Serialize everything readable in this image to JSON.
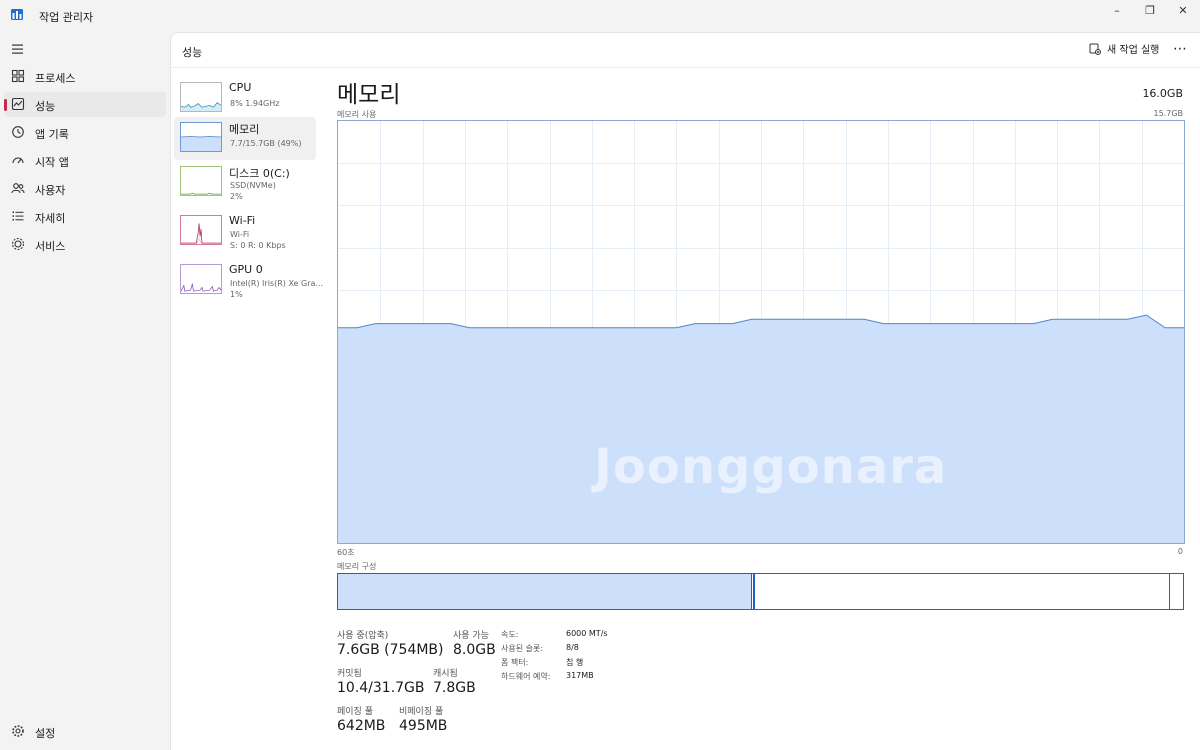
{
  "window": {
    "title": "작업 관리자",
    "minimize": "–",
    "restore": "❐",
    "close": "✕"
  },
  "nav": {
    "items": [
      {
        "label": "프로세스",
        "icon": "grid-icon"
      },
      {
        "label": "성능",
        "icon": "performance-icon"
      },
      {
        "label": "앱 기록",
        "icon": "history-icon"
      },
      {
        "label": "시작 앱",
        "icon": "startup-icon"
      },
      {
        "label": "사용자",
        "icon": "users-icon"
      },
      {
        "label": "자세히",
        "icon": "list-icon"
      },
      {
        "label": "서비스",
        "icon": "services-icon"
      }
    ],
    "settings_label": "설정"
  },
  "header": {
    "title": "성능",
    "run_task": "새 작업 실행",
    "more": "⋯"
  },
  "resources": [
    {
      "name": "CPU",
      "line1": "8% 1.94GHz",
      "line2": ""
    },
    {
      "name": "메모리",
      "line1": "7.7/15.7GB (49%)",
      "line2": ""
    },
    {
      "name": "디스크 0(C:)",
      "line1": "SSD(NVMe)",
      "line2": "2%"
    },
    {
      "name": "Wi-Fi",
      "line1": "Wi-Fi",
      "line2": "S: 0  R: 0 Kbps"
    },
    {
      "name": "GPU 0",
      "line1": "Intel(R) Iris(R) Xe Gra...",
      "line2": "1%"
    }
  ],
  "memory": {
    "title": "메모리",
    "total": "16.0GB",
    "usage_label": "메모리 사용",
    "usage_max": "15.7GB",
    "time_left": "60초",
    "time_right": "0",
    "composition_label": "메모리 구성",
    "composition_in_use_fraction": 0.49,
    "stats": {
      "in_use_label": "사용 중(압축)",
      "in_use_value": "7.6GB (754MB)",
      "available_label": "사용 가능",
      "available_value": "8.0GB",
      "committed_label": "커밋됨",
      "committed_value": "10.4/31.7GB",
      "cached_label": "캐시됨",
      "cached_value": "7.8GB",
      "paged_label": "페이징 풀",
      "paged_value": "642MB",
      "nonpaged_label": "비페이징 풀",
      "nonpaged_value": "495MB"
    },
    "specs": [
      {
        "label": "속도:",
        "value": "6000 MT/s"
      },
      {
        "label": "사용된 슬롯:",
        "value": "8/8"
      },
      {
        "label": "폼 팩터:",
        "value": "칩 행"
      },
      {
        "label": "하드웨어 예약:",
        "value": "317MB"
      }
    ],
    "usage_history_percent": [
      51,
      51,
      52,
      52,
      52,
      52,
      52,
      51,
      51,
      51,
      51,
      51,
      51,
      51,
      51,
      51,
      51,
      51,
      51,
      52,
      52,
      52,
      53,
      53,
      53,
      53,
      53,
      53,
      53,
      52,
      52,
      52,
      52,
      52,
      52,
      52,
      52,
      52,
      53,
      53,
      53,
      53,
      53,
      54,
      51,
      51
    ]
  },
  "watermark": "Joonggonara",
  "colors": {
    "accent": "#1f62c2",
    "memory_fill": "#cce0fb",
    "memory_line": "#4f86c6",
    "nav_indicator": "#c42b4b"
  }
}
